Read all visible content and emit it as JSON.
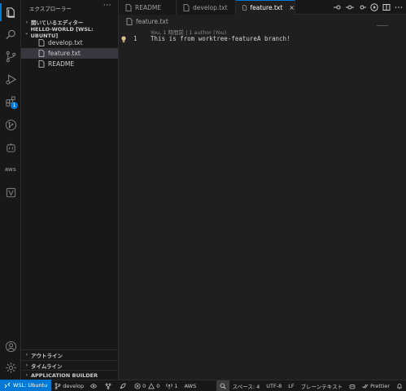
{
  "sidebar": {
    "title": "エクスプローラー",
    "more": "···",
    "open_editors": "開いているエディター",
    "workspace": "HELLO-WORLD [WSL: UBUNTU]",
    "files": [
      {
        "name": "develop.txt"
      },
      {
        "name": "feature.txt"
      },
      {
        "name": "README"
      }
    ],
    "outline": "アウトライン",
    "timeline": "タイムライン",
    "app_builder": "APPLICATION BUILDER"
  },
  "activity": {
    "extensions_badge": "1",
    "aws_label": "aws"
  },
  "tabs": [
    {
      "label": "README"
    },
    {
      "label": "develop.txt"
    },
    {
      "label": "feature.txt",
      "close": "×"
    }
  ],
  "editor": {
    "breadcrumb": "feature.txt",
    "blame": "You, 1 時間前 | 1 author (You)",
    "line_number": "1",
    "line_text": "This is from worktree-featureA branch!"
  },
  "statusbar": {
    "remote": "WSL: Ubuntu",
    "branch": "develop",
    "errors": "0",
    "warnings": "0",
    "ports": "1",
    "aws": "AWS",
    "spaces": "スペース: 4",
    "encoding": "UTF-8",
    "eol": "LF",
    "language": "プレーンテキスト",
    "prettier": "Prettier"
  },
  "colors": {
    "accent": "#0078d4",
    "background": "#1f1f1f",
    "sidebar": "#181818",
    "selection": "#37373d",
    "lightbulb": "#e2c08d"
  }
}
